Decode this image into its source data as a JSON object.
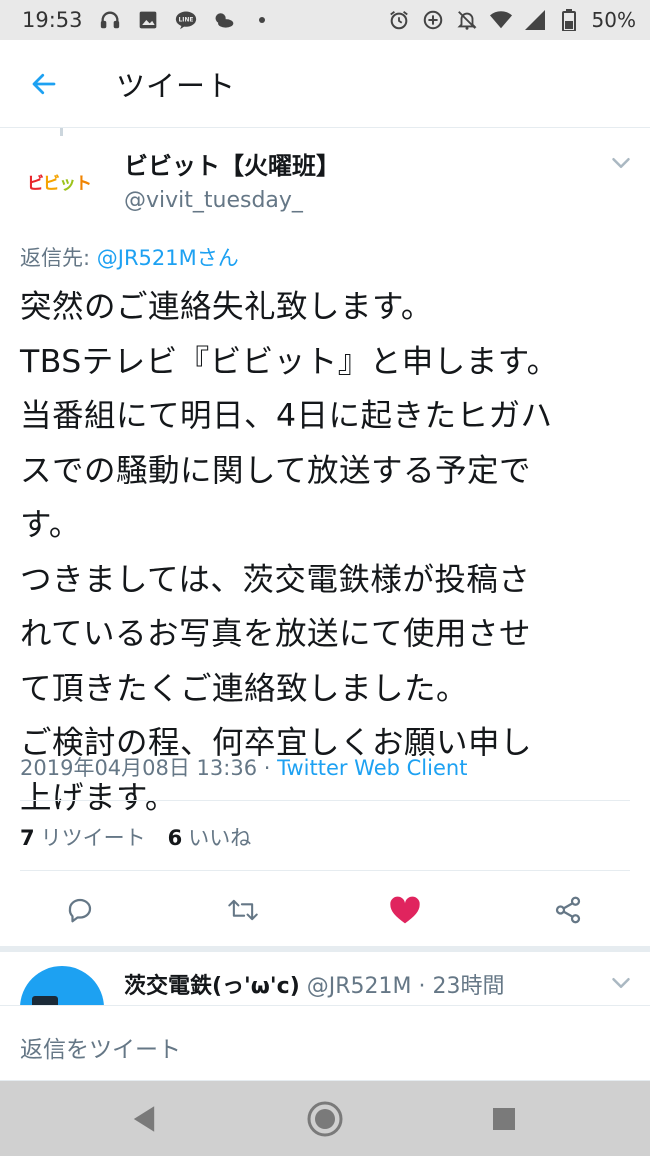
{
  "status_bar": {
    "time": "19:53",
    "battery": "50%",
    "left_icons": [
      "headphones-icon",
      "image-icon",
      "line-app-icon",
      "weather-icon",
      "dot-icon"
    ],
    "right_icons": [
      "alarm-icon",
      "data-saver-icon",
      "notifications-off-icon",
      "wifi-icon",
      "signal-icon",
      "battery-icon"
    ]
  },
  "header": {
    "title": "ツイート"
  },
  "tweet": {
    "avatar_text": "ビビット",
    "display_name": "ビビット【火曜班】",
    "handle": "@vivit_tuesday_",
    "reply_label": "返信先: ",
    "reply_mention": "@JR521Mさん",
    "lines": [
      "突然のご連絡失礼致します。",
      "TBSテレビ『ビビット』と申します。",
      "当番組にて明日、4日に起きたヒガハ",
      "スでの騒動に関して放送する予定で",
      "す。",
      "つきましては、茨交電鉄様が投稿さ",
      "れているお写真を放送にて使用させ",
      "て頂きたくご連絡致しました。",
      "ご検討の程、何卒宜しくお願い申し",
      "上げます。"
    ],
    "timestamp": "2019年04月08日 13:36 · ",
    "client": "Twitter Web Client",
    "retweet_count": "7",
    "retweet_label": "リツイート",
    "like_count": "6",
    "like_label": "いいね"
  },
  "next_tweet": {
    "name": "茨交電鉄(っ'ω'c)",
    "handle_time": " @JR521M · 23時間"
  },
  "reply_bar": {
    "placeholder": "返信をツイート"
  },
  "colors": {
    "accent": "#1da1f2",
    "like": "#e0245e",
    "muted_text": "#657786"
  }
}
